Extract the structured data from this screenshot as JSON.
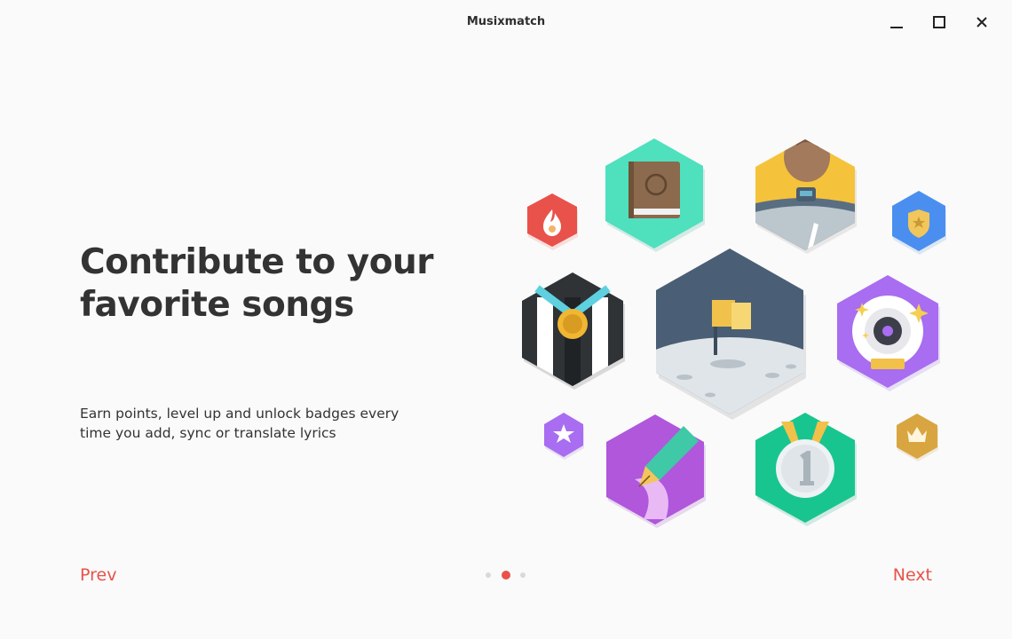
{
  "window": {
    "title": "Musixmatch",
    "controls": [
      "minimize-icon",
      "maximize-icon",
      "close-icon"
    ]
  },
  "onboarding": {
    "headline": "Contribute to your favorite songs",
    "description": "Earn points, level up and unlock badges every time you add, sync or translate lyrics",
    "badges": [
      "flame-badge",
      "book-badge",
      "astronaut-badge",
      "police-star-badge",
      "medal-badge",
      "moon-flag-badge",
      "vinyl-badge",
      "star-badge",
      "pen-badge",
      "first-place-badge",
      "crown-badge"
    ]
  },
  "pager": {
    "total": 3,
    "active_index": 1
  },
  "nav": {
    "prev_label": "Prev",
    "next_label": "Next"
  },
  "colors": {
    "accent": "#e8524a",
    "background": "#fafafa",
    "text": "#333333"
  }
}
